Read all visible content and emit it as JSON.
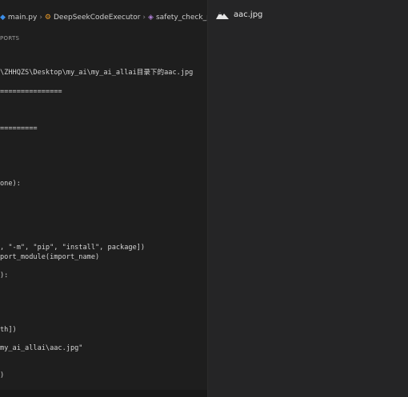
{
  "breadcrumb": {
    "file": "main.py",
    "class": "DeepSeekCodeExecutor",
    "method": "safety_check_prompt"
  },
  "panel": {
    "ports_label": "PORTS"
  },
  "terminal": {
    "lines": [
      "\\ZHHQZS\\Desktop\\my_ai\\my_ai_allai目录下的aac.jpg",
      "===============",
      "=========",
      "one):",
      ", \"-m\", \"pip\", \"install\", package])",
      "port_module(import_name)",
      "):",
      "th])",
      "my_ai_allai\\aac.jpg\"",
      ")"
    ]
  },
  "viewer": {
    "title": "aac.jpg",
    "logo_icon": "mountain-logo-icon"
  },
  "colors": {
    "editor_bg": "#1e1e1e",
    "viewer_bg": "#252526",
    "text": "#d4d4d4"
  }
}
